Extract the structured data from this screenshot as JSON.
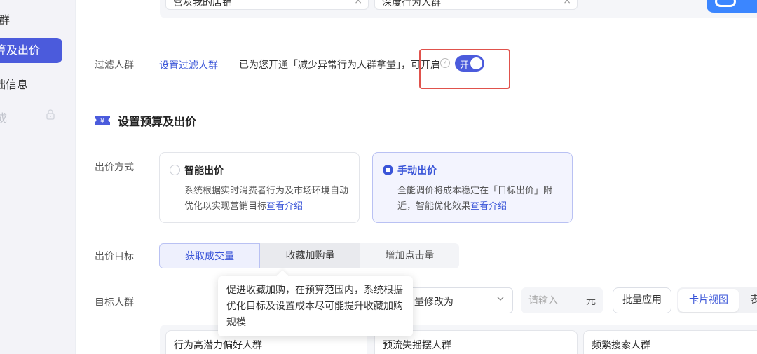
{
  "sidebar": {
    "items": [
      {
        "label": "群"
      },
      {
        "label": "算及出价"
      },
      {
        "label": "础信息"
      },
      {
        "label": "成"
      }
    ]
  },
  "top": {
    "field1": "营灰我的店铺",
    "field2": "深度行为人群",
    "clear_glyph": "×"
  },
  "filter": {
    "label": "过滤人群",
    "link": "设置过滤人群",
    "text": "已为您开通「减少异常行为人群拿量」，可开启",
    "help_glyph": "?",
    "toggle_label": "开",
    "toggle_on": true
  },
  "section": {
    "title": "设置预算及出价"
  },
  "bid_method": {
    "label": "出价方式",
    "options": [
      {
        "title": "智能出价",
        "desc": "系统根据实时消费者行为及市场环境自动优化以实现营销目标",
        "link": "查看介绍",
        "selected": false
      },
      {
        "title": "手动出价",
        "desc": "全能调价将成本稳定在「目标出价」附近，智能优化效果",
        "link": "查看介绍",
        "selected": true
      }
    ]
  },
  "bid_goal": {
    "label": "出价目标",
    "options": [
      "获取成交量",
      "收藏加购量",
      "增加点击量"
    ],
    "selected": "获取成交量"
  },
  "tooltip": {
    "text": "促进收藏加购，在预算范围内，系统根据优化目标及设置成本尽可能提升收藏加购规模"
  },
  "target_audience": {
    "label": "目标人群",
    "batch_select_value": "量修改为",
    "input_placeholder": "请输入",
    "unit": "元",
    "batch_apply": "批量应用",
    "view_card": "卡片视图",
    "view_table": "表"
  },
  "audiences": [
    {
      "name": "行为高潜力偏好人群"
    },
    {
      "name": "预流失摇摆人群"
    },
    {
      "name": "频繁搜索人群"
    }
  ],
  "colors": {
    "accent": "#4b5bdc",
    "link": "#3a55d8",
    "highlight": "#e0524c"
  }
}
